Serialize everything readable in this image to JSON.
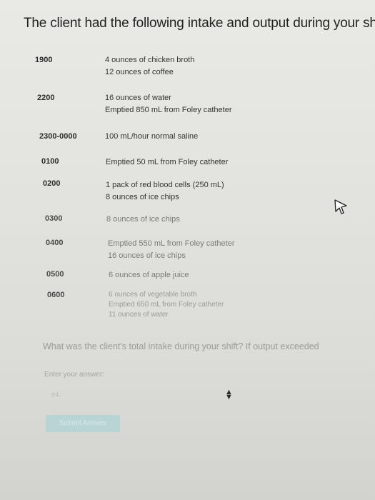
{
  "title": "The client had the following intake and output during your shift",
  "intake_output_log": [
    {
      "time": "1900",
      "entries": [
        "4 ounces of chicken broth",
        "12 ounces of coffee"
      ]
    },
    {
      "time": "2200",
      "entries": [
        "16 ounces of water",
        "Emptied 850 mL from Foley catheter"
      ]
    },
    {
      "time": "2300-0000",
      "entries": [
        "100 mL/hour normal saline"
      ]
    },
    {
      "time": "0100",
      "entries": [
        "Emptied 50 mL from Foley catheter"
      ]
    },
    {
      "time": "0200",
      "entries": [
        "1 pack of red blood cells (250 mL)",
        "8 ounces of ice chips"
      ]
    },
    {
      "time": "0300",
      "entries": [
        "8 ounces of ice chips"
      ]
    },
    {
      "time": "0400",
      "entries": [
        "Emptied 550 mL from Foley catheter",
        "16 ounces of ice chips"
      ]
    },
    {
      "time": "0500",
      "entries": [
        "6 ounces of apple juice"
      ]
    },
    {
      "time": "0600",
      "entries": [
        "6 ounces of vegetable broth",
        "Emptied 650 mL from Foley catheter",
        "11 ounces of water"
      ]
    }
  ],
  "question": "What was the client's total intake during your shift? If output exceeded",
  "answer": {
    "label": "Enter your answer:",
    "unit": "mL",
    "value": ""
  },
  "submit_label": "Submit Answer",
  "icons": {
    "stepper": "up-down-arrows-icon",
    "cursor": "mouse-pointer-icon"
  },
  "colors": {
    "submit_button": "#b8d4d4",
    "faded_text": "#9a9a98"
  }
}
